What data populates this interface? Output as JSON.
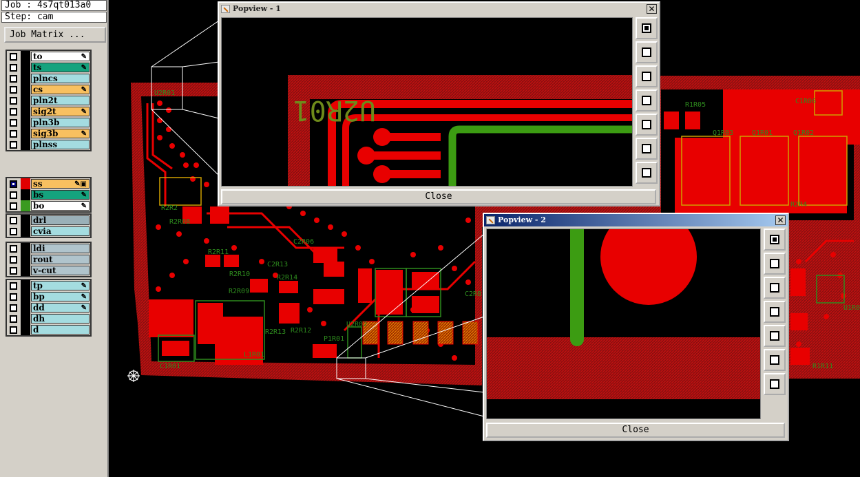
{
  "job_line": "Job : 4s7qt013a0",
  "step_line": "Step: cam",
  "job_matrix_label": "Job Matrix ...",
  "layers": [
    {
      "name": "to",
      "color": "#ffffff",
      "swatch": "#000000",
      "mark": "✎",
      "checked": false
    },
    {
      "name": "ts",
      "color": "#15a37e",
      "swatch": "#000000",
      "mark": "✎",
      "checked": false
    },
    {
      "name": "plncs",
      "color": "#a4dce0",
      "swatch": "#000000",
      "mark": "",
      "checked": false
    },
    {
      "name": "cs",
      "color": "#f8c060",
      "swatch": "#000000",
      "mark": "✎",
      "checked": false
    },
    {
      "name": "pln2t",
      "color": "#a4dce0",
      "swatch": "#000000",
      "mark": "",
      "checked": false
    },
    {
      "name": "sig2t",
      "color": "#f8c060",
      "swatch": "#000000",
      "mark": "✎",
      "checked": false
    },
    {
      "name": "pln3b",
      "color": "#a4dce0",
      "swatch": "#000000",
      "mark": "",
      "checked": false
    },
    {
      "name": "sig3b",
      "color": "#f8c060",
      "swatch": "#000000",
      "mark": "✎",
      "checked": false
    },
    {
      "name": "plnss",
      "color": "#a4dce0",
      "swatch": "#000000",
      "mark": "",
      "checked": false
    },
    {
      "name": "ss",
      "color": "#f8c060",
      "swatch": "#e00000",
      "mark": "✎▣",
      "checked": true
    },
    {
      "name": "bs",
      "color": "#15a37e",
      "swatch": "#000000",
      "mark": "✎",
      "checked": false
    },
    {
      "name": "bo",
      "color": "#ffffff",
      "swatch": "#3a9a20",
      "mark": "✎",
      "checked": false
    },
    {
      "name": "drl",
      "color": "#9ab0b8",
      "swatch": "#000000",
      "mark": "",
      "checked": false
    },
    {
      "name": "cvia",
      "color": "#a4dce0",
      "swatch": "#000000",
      "mark": "",
      "checked": false
    },
    {
      "name": "ldi",
      "color": "#b0c4cc",
      "swatch": "#000000",
      "mark": "",
      "checked": false
    },
    {
      "name": "rout",
      "color": "#b0c4cc",
      "swatch": "#000000",
      "mark": "",
      "checked": false
    },
    {
      "name": "v-cut",
      "color": "#b0c4cc",
      "swatch": "#000000",
      "mark": "",
      "checked": false
    },
    {
      "name": "tp",
      "color": "#a4dce0",
      "swatch": "#000000",
      "mark": "✎",
      "checked": false
    },
    {
      "name": "bp",
      "color": "#a4dce0",
      "swatch": "#000000",
      "mark": "✎",
      "checked": false
    },
    {
      "name": "dd",
      "color": "#a4dce0",
      "swatch": "#000000",
      "mark": "✎",
      "checked": false
    },
    {
      "name": "dh",
      "color": "#a4dce0",
      "swatch": "#000000",
      "mark": "",
      "checked": false
    },
    {
      "name": "d",
      "color": "#a4dce0",
      "swatch": "#000000",
      "mark": "",
      "checked": false
    }
  ],
  "popview1": {
    "title": "Popview - 1",
    "close": "Close",
    "close_x": "✕",
    "label_text": "U2R01"
  },
  "popview2": {
    "title": "Popview - 2",
    "close": "Close",
    "close_x": "✕"
  },
  "board_labels": {
    "u2r01": "U2R01",
    "r2r2": "R2R2",
    "r2r12": "R2R12",
    "r2r13": "R2R13",
    "r2r10": "R2R10",
    "r2r09": "R2R09",
    "r2r14": "R2R14",
    "r2r11": "R2R11",
    "c2r13": "C2R13",
    "c2r06": "C2R06",
    "l1r01": "L1R01",
    "c1r01": "C1R01",
    "p1r01": "P1R01",
    "u2r02": "U2R02",
    "q1r01": "Q1R01",
    "q1r02": "Q1R02",
    "q1r03": "Q1R03",
    "c1r06": "C1R06",
    "r1r05": "R1R05",
    "r1r11": "R1R11",
    "u1r02": "U1R02",
    "c2r8": "C2R8",
    "r2r08": "R2R08",
    "r2r4": "R2R4"
  },
  "colors": {
    "copper": "#e80000",
    "silk": "#2e8b1e",
    "mask": "#cfa000",
    "board": "#000000"
  }
}
